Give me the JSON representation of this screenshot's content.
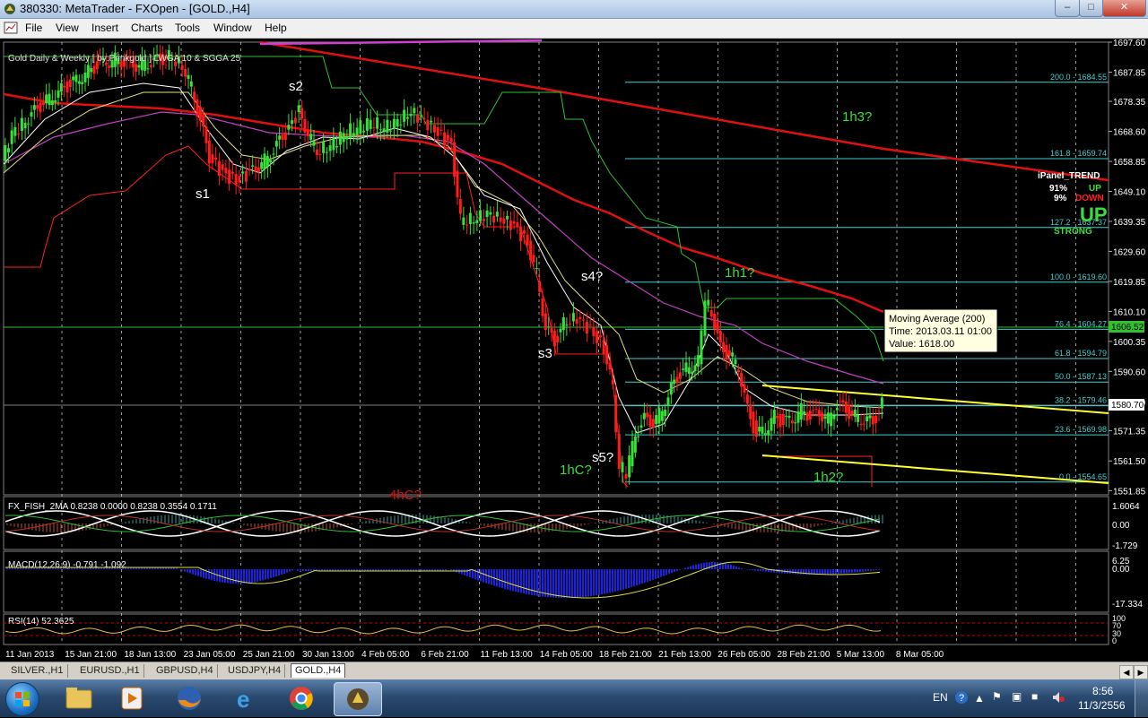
{
  "window": {
    "title": "380330: MetaTrader - FXOpen - [GOLD.,H4]",
    "min_icon": "minimize-icon",
    "max_icon": "maximize-icon",
    "close_icon": "close-icon"
  },
  "menu": [
    "File",
    "View",
    "Insert",
    "Charts",
    "Tools",
    "Window",
    "Help"
  ],
  "chart": {
    "header": "Gold Daily & Weekly [ by:Prinkgold ] LWGA 10  &  SGGA 25",
    "price_axis": [
      "1697.60",
      "1687.85",
      "1678.35",
      "1668.60",
      "1658.85",
      "1649.10",
      "1639.35",
      "1629.60",
      "1619.85",
      "1610.10",
      "1600.35",
      "1590.60",
      "1580.70",
      "1571.35",
      "1561.50",
      "1551.85"
    ],
    "current_price": "1580.70",
    "other_price": "1606.52",
    "fib_levels": [
      "200.0 - 1684.55",
      "161.8 - 1659.74",
      "127.2 - 1637.37",
      "100.0 - 1619.60",
      "76.4 - 1604.27",
      "61.8 - 1594.79",
      "50.0 - 1587.13",
      "38.2 - 1579.46",
      "23.6 - 1569.98",
      "0.0 - 1554.65"
    ],
    "wave_labels": {
      "s1": "s1",
      "s2": "s2",
      "s3": "s3",
      "s4": "s4?",
      "s5": "s5?",
      "h1c": "1hC?",
      "h1h1": "1h1?",
      "h1h2": "1h2?",
      "h1h3": "1h3?",
      "h4c": "4hC?"
    },
    "ipanel": {
      "title": "iPanel_TREND",
      "up_pct": "91%",
      "up_label": "UP",
      "down_pct": "9%",
      "down_label": "DOWN",
      "trend": "UP",
      "strength": "STRONG"
    },
    "tooltip": {
      "line1": "Moving Average (200)",
      "line2": "Time: 2013.03.11 01:00",
      "line3": "Value: 1618.00"
    },
    "fisher": {
      "label": "FX_FISH_2MA 0.8238 0.0000 0.8238 0.3554 0.1711",
      "ticks": [
        "1.6064",
        "0.00",
        "-1.729"
      ]
    },
    "macd": {
      "label": "MACD(12,26,9) -0.791 -1.092",
      "ticks": [
        "6.25",
        "0.00",
        "-17.334"
      ]
    },
    "rsi": {
      "label": "RSI(14) 52.3625",
      "ticks": [
        "100",
        "70",
        "30",
        "0"
      ]
    },
    "time_axis": [
      "11 Jan 2013",
      "15 Jan 21:00",
      "18 Jan 13:00",
      "23 Jan 05:00",
      "25 Jan 21:00",
      "30 Jan 13:00",
      "4 Feb 05:00",
      "6 Feb 21:00",
      "11 Feb 13:00",
      "14 Feb 05:00",
      "18 Feb 21:00",
      "21 Feb 13:00",
      "26 Feb 05:00",
      "28 Feb 21:00",
      "5 Mar 13:00",
      "8 Mar 05:00"
    ]
  },
  "tabs": [
    {
      "label": "SILVER.,H1",
      "active": false
    },
    {
      "label": "EURUSD.,H1",
      "active": false
    },
    {
      "label": "GBPUSD,H4",
      "active": false
    },
    {
      "label": "USDJPY,H4",
      "active": false
    },
    {
      "label": "GOLD.,H4",
      "active": true
    }
  ],
  "taskbar": {
    "apps": [
      "windows-explorer-icon",
      "media-player-icon",
      "firefox-icon",
      "internet-explorer-icon",
      "chrome-icon",
      "metatrader-icon"
    ],
    "lang": "EN",
    "time": "8:56",
    "date": "11/3/2556"
  },
  "colors": {
    "bull": "#39e03a",
    "bear": "#ff1c1c",
    "fib": "#40d0d0",
    "ma_red": "#e01010",
    "yellow": "#ffff33",
    "magenta": "#c040c0",
    "green_line": "#30c030"
  }
}
